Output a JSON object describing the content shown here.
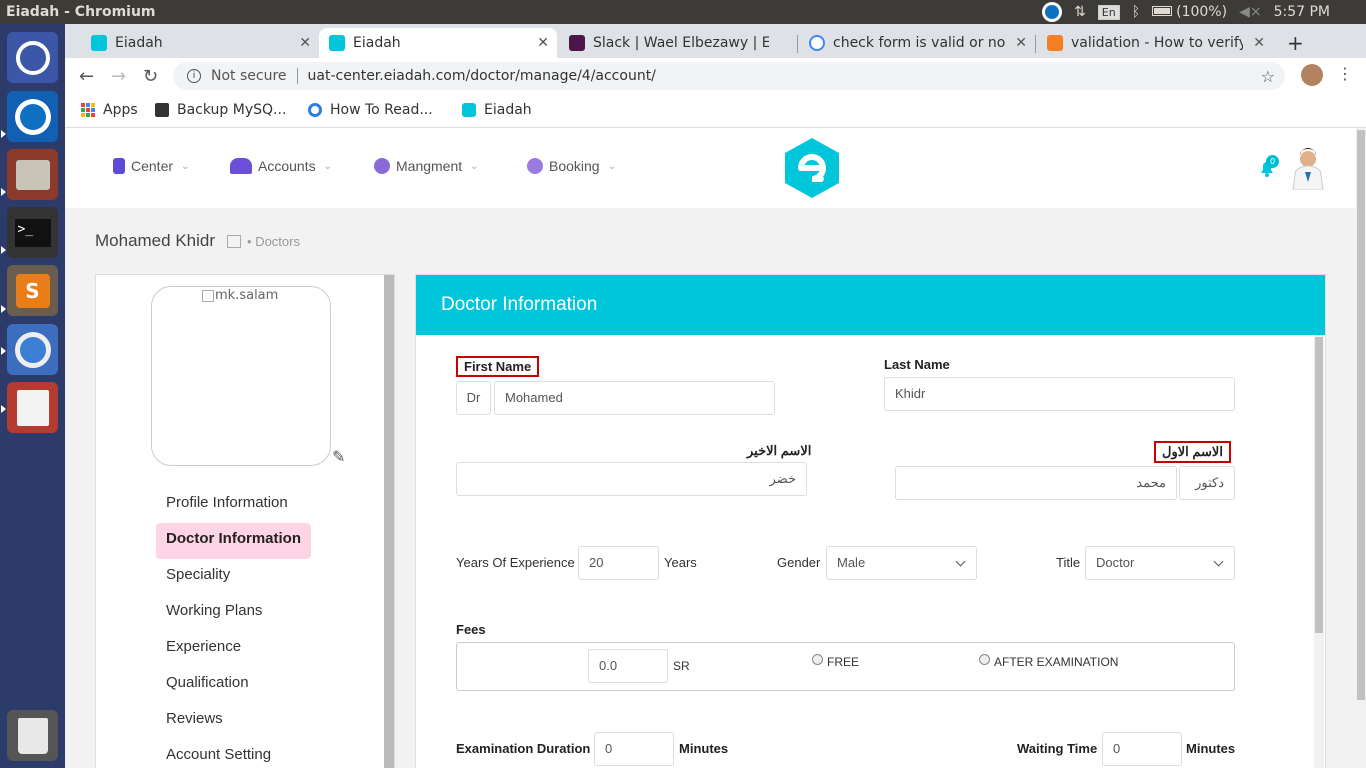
{
  "os": {
    "window_title": "Eiadah - Chromium",
    "keyboard": "En",
    "battery": "(100%)",
    "clock": "5:57 PM"
  },
  "browser": {
    "tabs": [
      {
        "label": "Eiadah"
      },
      {
        "label": "Eiadah"
      },
      {
        "label": "Slack | Wael Elbezawy | Eia"
      },
      {
        "label": "check form is valid or not"
      },
      {
        "label": "validation - How to verify"
      }
    ],
    "not_secure": "Not secure",
    "url": "uat-center.eiadah.com/doctor/manage/4/account/",
    "bookmarks": [
      {
        "label": "Apps"
      },
      {
        "label": "Backup MySQ..."
      },
      {
        "label": "How To Read..."
      },
      {
        "label": "Eiadah"
      }
    ]
  },
  "header": {
    "nav": [
      {
        "label": "Center"
      },
      {
        "label": "Accounts"
      },
      {
        "label": "Mangment"
      },
      {
        "label": "Booking"
      }
    ],
    "notification_count": "0"
  },
  "breadcrumb": {
    "user": "Mohamed Khidr",
    "section": "Doctors"
  },
  "sidebar": {
    "photo_alt": "mk.salam",
    "items": [
      {
        "label": "Profile Information"
      },
      {
        "label": "Doctor Information"
      },
      {
        "label": "Speciality"
      },
      {
        "label": "Working Plans"
      },
      {
        "label": "Experience"
      },
      {
        "label": "Qualification"
      },
      {
        "label": "Reviews"
      },
      {
        "label": "Account Setting"
      }
    ],
    "active_index": 1
  },
  "form": {
    "heading": "Doctor Information",
    "first_name_label": "First Name",
    "prefix_value": "Dr",
    "first_name_value": "Mohamed",
    "last_name_label": "Last Name",
    "last_name_value": "Khidr",
    "last_name_ar_label": "الاسم الاخير",
    "last_name_ar_value": "خضر",
    "first_name_ar_label": "الاسم الاول",
    "first_name_ar_value": "محمد",
    "prefix_ar_value": "دكتور",
    "experience_label": "Years Of Experience",
    "experience_value": "20",
    "experience_unit": "Years",
    "gender_label": "Gender",
    "gender_value": "Male",
    "title_label": "Title",
    "title_value": "Doctor",
    "fees_label": "Fees",
    "fees_value": "0.0",
    "fees_currency": "SR",
    "free_label": "FREE",
    "after_exam_label": "AFTER EXAMINATION",
    "exam_duration_label": "Examination Duration",
    "exam_duration_value": "0",
    "exam_duration_unit": "Minutes",
    "waiting_time_label": "Waiting Time",
    "waiting_time_value": "0",
    "waiting_time_unit": "Minutes"
  },
  "colors": {
    "accent": "#00c6dc",
    "active_menu": "#ffd5e5",
    "error_border": "#cc0000"
  }
}
